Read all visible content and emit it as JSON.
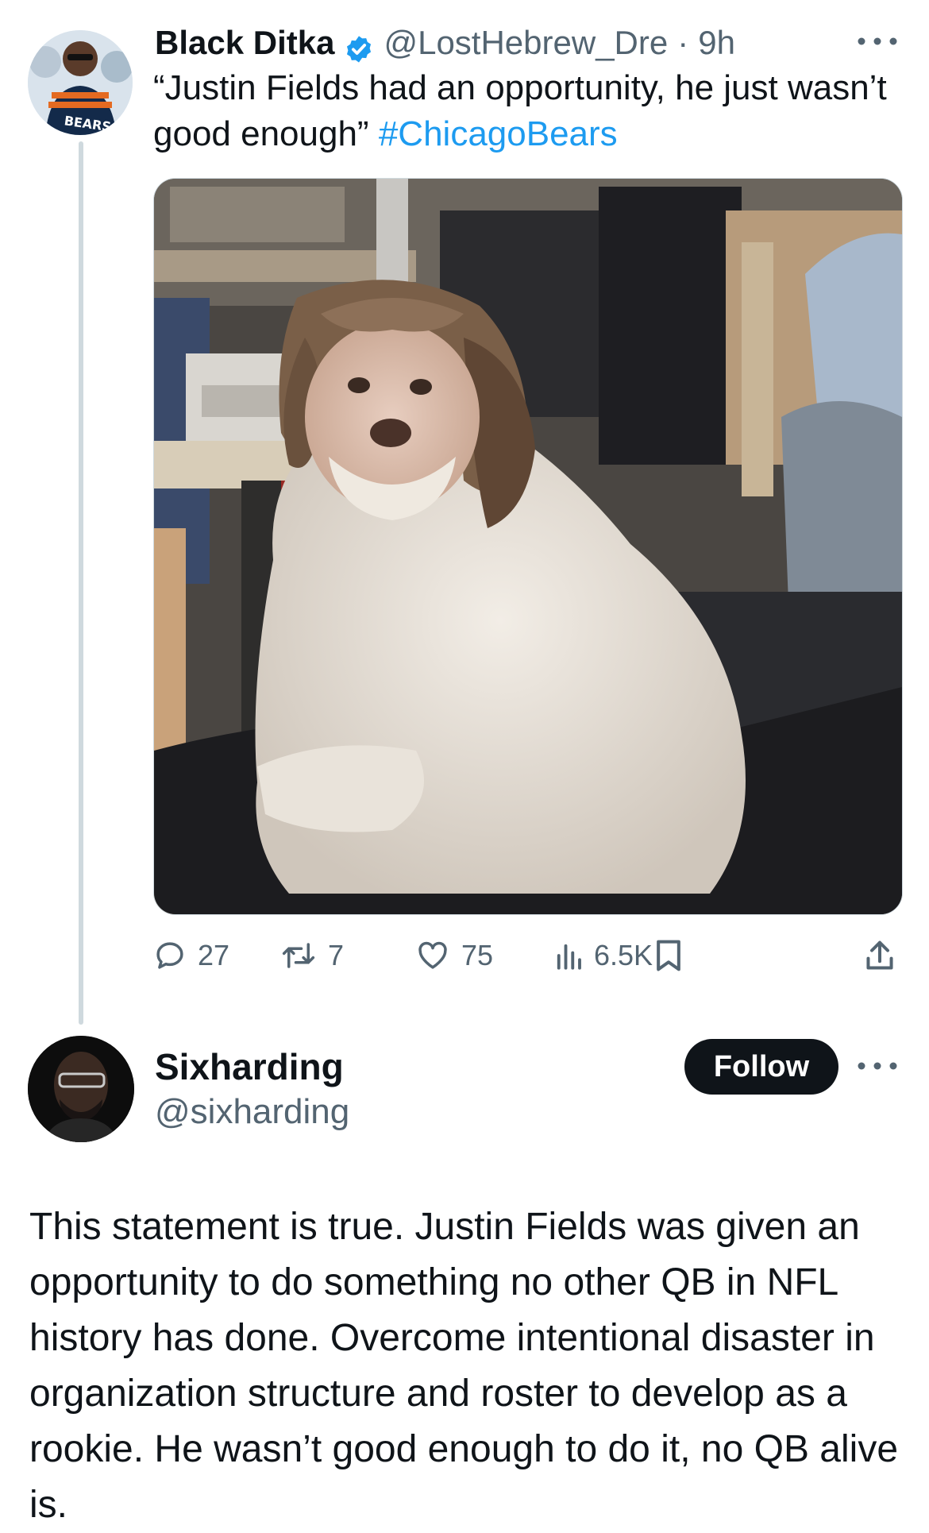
{
  "tweet": {
    "author_name": "Black Ditka",
    "handle": "@LostHebrew_Dre",
    "separator": "·",
    "time": "9h",
    "text": "“Justin Fields had an opportunity, he just wasn’t good enough”",
    "hashtag": "#ChicagoBears",
    "avatar_label": "BEARS",
    "stats": {
      "replies": "27",
      "reposts": "7",
      "likes": "75",
      "views": "6.5K"
    }
  },
  "reply": {
    "author_name": "Sixharding",
    "handle": "@sixharding",
    "follow_label": "Follow",
    "text": "This statement is true. Justin Fields was given an opportunity to do something no other QB in NFL history has done. Overcome intentional disaster in organization structure and roster to develop as a rookie. He wasn’t good enough to do it, no QB alive is."
  },
  "colors": {
    "link": "#1d9bf0",
    "text": "#0f1419",
    "muted": "#536471",
    "thread_line": "#cfd9de",
    "button_bg": "#0f1419"
  },
  "icons": {
    "more": "more-horizontal-icon",
    "verified": "verified-badge-icon",
    "reply": "reply-bubble-icon",
    "repost": "repost-arrows-icon",
    "like": "heart-icon",
    "views": "views-bars-icon",
    "bookmark": "bookmark-icon",
    "share": "share-upload-icon"
  }
}
